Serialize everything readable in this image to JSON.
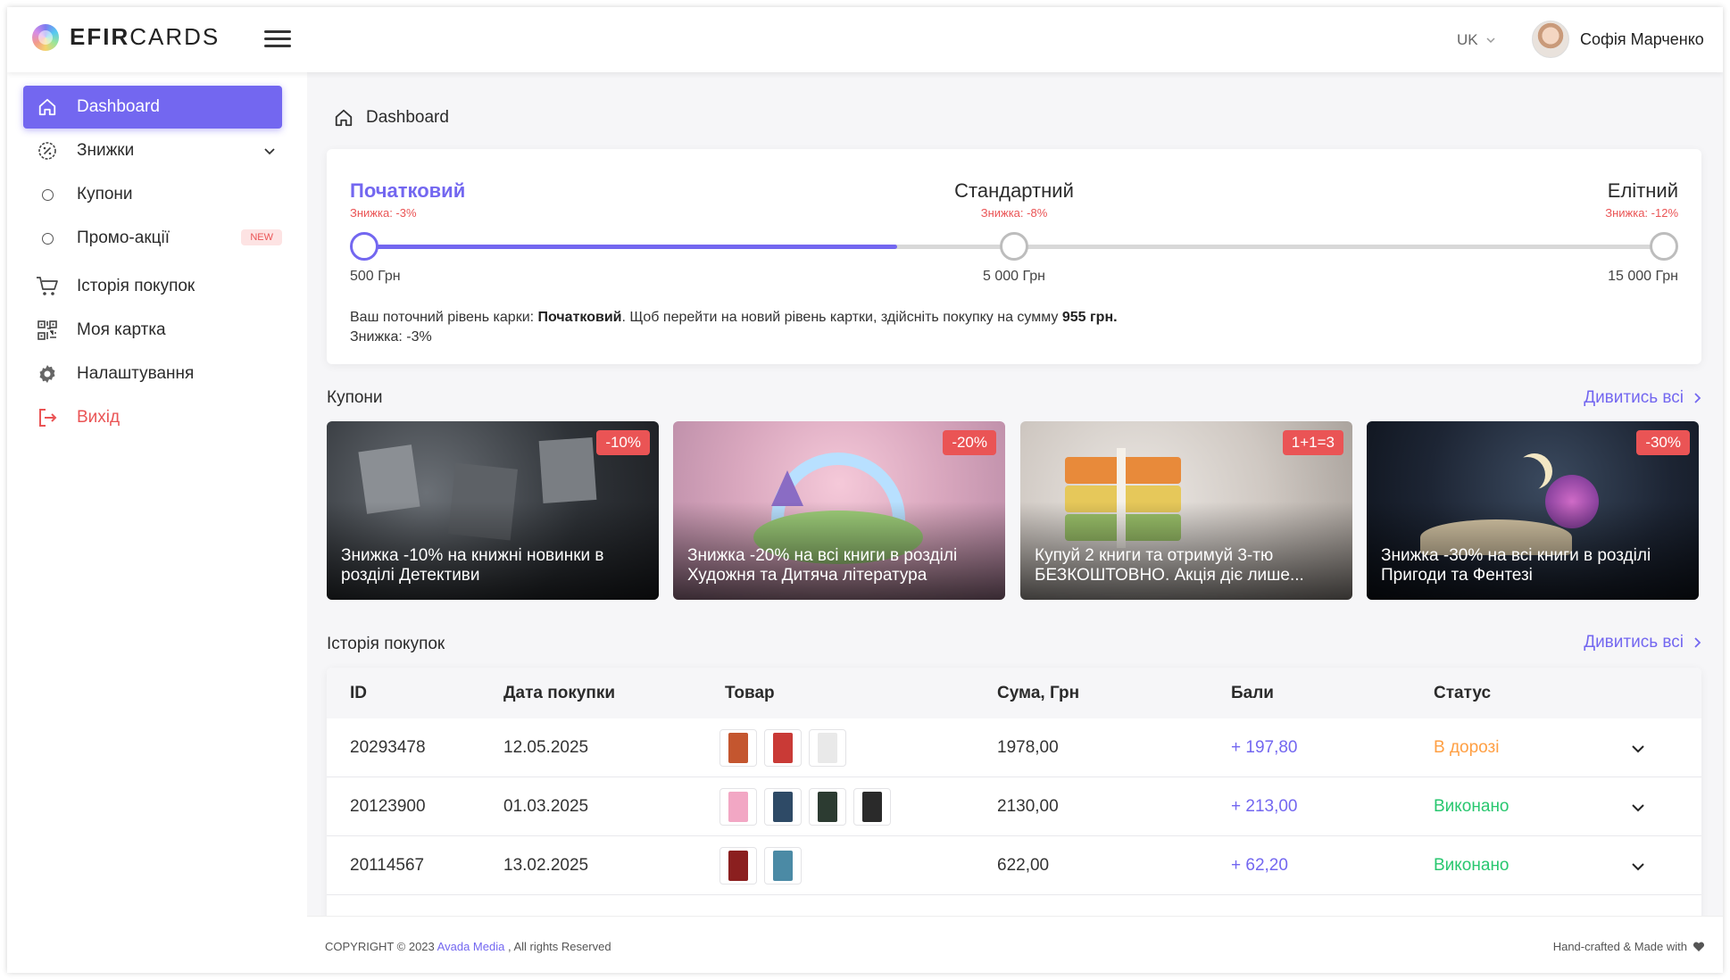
{
  "header": {
    "logo_bold": "EFIR",
    "logo_light": "CARDS",
    "language": "UK",
    "user_name": "Софія Марченко"
  },
  "sidebar": {
    "items": [
      {
        "label": "Dashboard",
        "icon": "home-icon",
        "active": true
      },
      {
        "label": "Знижки",
        "icon": "discount-icon",
        "expandable": true
      },
      {
        "label": "Купони",
        "icon": "circle-icon"
      },
      {
        "label": "Промо-акції",
        "icon": "circle-icon",
        "badge": "NEW"
      },
      {
        "label": "Історія покупок",
        "icon": "cart-icon"
      },
      {
        "label": "Моя картка",
        "icon": "qr-code-icon"
      },
      {
        "label": "Налаштування",
        "icon": "gear-icon"
      },
      {
        "label": "Вихід",
        "icon": "logout-icon"
      }
    ]
  },
  "breadcrumb": {
    "label": "Dashboard"
  },
  "levels": {
    "items": [
      {
        "name": "Початковий",
        "discount": "Знижка: -3%",
        "amount": "500 Грн",
        "current": true
      },
      {
        "name": "Стандартний",
        "discount": "Знижка: -8%",
        "amount": "5 000 Грн"
      },
      {
        "name": "Елітний",
        "discount": "Знижка: -12%",
        "amount": "15 000 Грн"
      }
    ],
    "progress_fraction": 0.41,
    "info_prefix": "Ваш поточний рівень карки: ",
    "info_level": "Початковий",
    "info_middle": ". Щоб перейти на новий рівень картки, здійсніть покупку на сумму ",
    "info_amount": "955 грн.",
    "info_discount": "Знижка: -3%"
  },
  "coupons": {
    "title": "Купони",
    "see_all": "Дивитись всі",
    "items": [
      {
        "tag": "-10%",
        "text": "Знижка -10% на книжні новинки в розділі Детективи"
      },
      {
        "tag": "-20%",
        "text": "Знижка -20% на всі книги в розділі Художня та Дитяча література"
      },
      {
        "tag": "1+1=3",
        "text": "Купуй 2 книги та отримуй 3-тю БЕЗКОШТОВНО. Акція діє лише..."
      },
      {
        "tag": "-30%",
        "text": "Знижка -30% на всі книги в розділі Пригоди та Фентезі"
      }
    ]
  },
  "history": {
    "title": "Історія покупок",
    "see_all": "Дивитись всі",
    "columns": [
      "ID",
      "Дата покупки",
      "Товар",
      "Сума, Грн",
      "Бали",
      "Статус"
    ],
    "rows": [
      {
        "id": "20293478",
        "date": "12.05.2025",
        "sum": "1978,00",
        "points": "+ 197,80",
        "status": "В дорозі",
        "status_kind": "road",
        "thumbs": [
          "#c4562f",
          "#c93a36",
          "#e9e9e9"
        ]
      },
      {
        "id": "20123900",
        "date": "01.03.2025",
        "sum": "2130,00",
        "points": "+ 213,00",
        "status": "Виконано",
        "status_kind": "done",
        "thumbs": [
          "#f2a7c4",
          "#2e4a66",
          "#2c3b31",
          "#2a2a2a"
        ]
      },
      {
        "id": "20114567",
        "date": "13.02.2025",
        "sum": "622,00",
        "points": "+ 62,20",
        "status": "Виконано",
        "status_kind": "done",
        "thumbs": [
          "#8b1f1f",
          "#4b8aa5"
        ]
      }
    ]
  },
  "footer": {
    "copyright": "COPYRIGHT © 2023 ",
    "company": "Avada Media",
    "rights": " , All rights Reserved",
    "right_text": "Hand-crafted & Made with"
  },
  "colors": {
    "accent": "#7367f0",
    "danger": "#ea5455",
    "warning": "#ff9f43",
    "success": "#28c76f"
  }
}
